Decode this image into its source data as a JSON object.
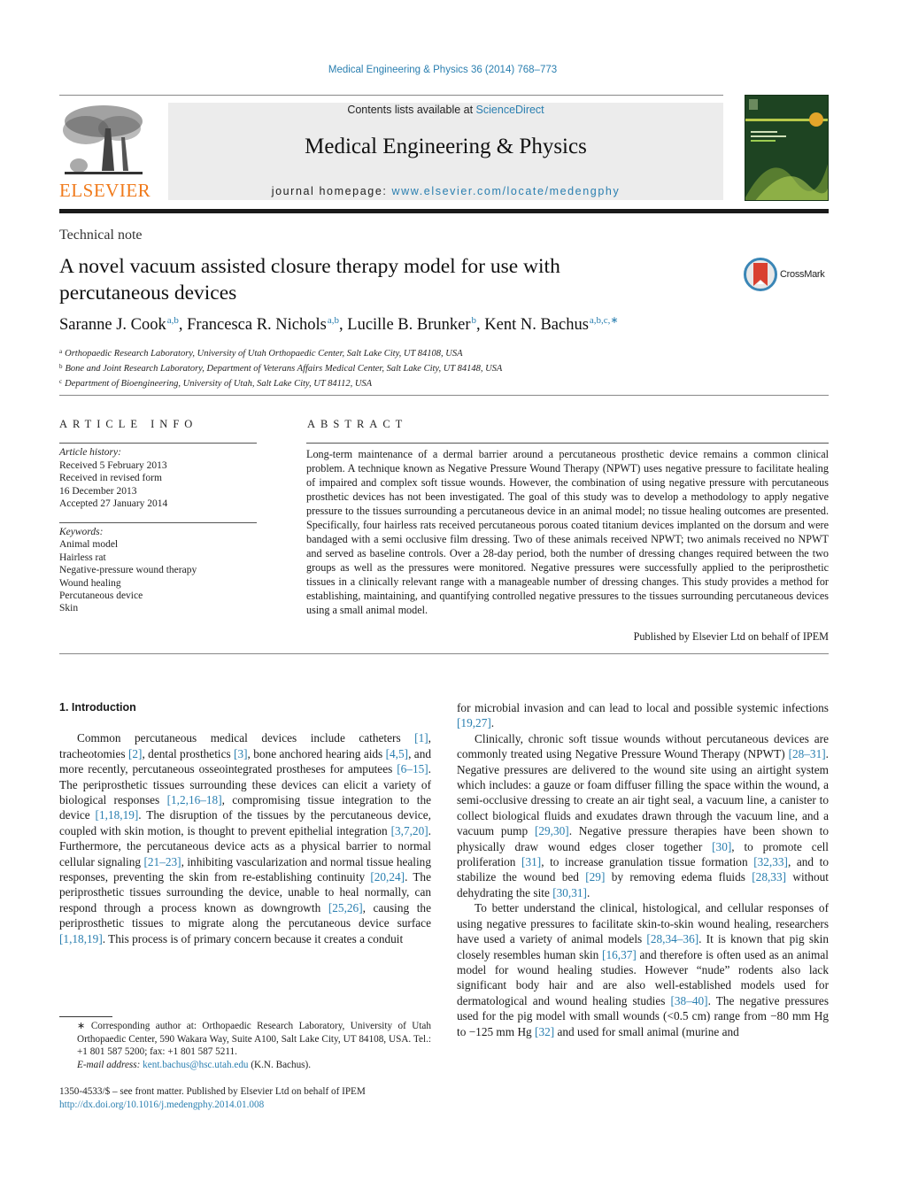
{
  "header": {
    "citation": "Medical Engineering & Physics 36 (2014) 768–773",
    "publisher_logo_text": "ELSEVIER",
    "contents_prefix": "Contents lists available at ",
    "contents_link": "ScienceDirect",
    "journal_title": "Medical Engineering & Physics",
    "homepage_prefix": "journal homepage: ",
    "homepage_link": "www.elsevier.com/locate/medengphy",
    "crossmark_label": "CrossMark"
  },
  "colors": {
    "link": "#2a7fb0",
    "elsevier_orange": "#f07a1b",
    "cover_green": "#1e4422",
    "crossmark_red": "#d9402f"
  },
  "article": {
    "type": "Technical note",
    "title_line1": "A novel vacuum assisted closure therapy model for use with",
    "title_line2": "percutaneous devices",
    "authors": [
      {
        "name": "Saranne J. Cook",
        "sup": "a,b",
        "sep": ", "
      },
      {
        "name": "Francesca R. Nichols",
        "sup": "a,b",
        "sep": ", "
      },
      {
        "name": "Lucille B. Brunker",
        "sup": "b",
        "sep": ", "
      },
      {
        "name": "Kent N. Bachus",
        "sup": "a,b,c,∗",
        "sep": ""
      }
    ],
    "affiliations": [
      {
        "key": "a",
        "text": "Orthopaedic Research Laboratory, University of Utah Orthopaedic Center, Salt Lake City, UT 84108, USA"
      },
      {
        "key": "b",
        "text": "Bone and Joint Research Laboratory, Department of Veterans Affairs Medical Center, Salt Lake City, UT 84148, USA"
      },
      {
        "key": "c",
        "text": "Department of Bioengineering, University of Utah, Salt Lake City, UT 84112, USA"
      }
    ]
  },
  "article_info": {
    "heading": "ARTICLE INFO",
    "history_label": "Article history:",
    "history": [
      "Received 5 February 2013",
      "Received in revised form",
      "16 December 2013",
      "Accepted 27 January 2014"
    ],
    "keywords_label": "Keywords:",
    "keywords": [
      "Animal model",
      "Hairless rat",
      "Negative-pressure wound therapy",
      "Wound healing",
      "Percutaneous device",
      "Skin"
    ]
  },
  "abstract": {
    "heading": "ABSTRACT",
    "text": "Long-term maintenance of a dermal barrier around a percutaneous prosthetic device remains a common clinical problem. A technique known as Negative Pressure Wound Therapy (NPWT) uses negative pressure to facilitate healing of impaired and complex soft tissue wounds. However, the combination of using negative pressure with percutaneous prosthetic devices has not been investigated. The goal of this study was to develop a methodology to apply negative pressure to the tissues surrounding a percutaneous device in an animal model; no tissue healing outcomes are presented. Specifically, four hairless rats received percutaneous porous coated titanium devices implanted on the dorsum and were bandaged with a semi occlusive film dressing. Two of these animals received NPWT; two animals received no NPWT and served as baseline controls. Over a 28-day period, both the number of dressing changes required between the two groups as well as the pressures were monitored. Negative pressures were successfully applied to the periprosthetic tissues in a clinically relevant range with a manageable number of dressing changes. This study provides a method for establishing, maintaining, and quantifying controlled negative pressures to the tissues surrounding percutaneous devices using a small animal model.",
    "publisher_note": "Published by Elsevier Ltd on behalf of IPEM"
  },
  "body": {
    "section_heading": "1.  Introduction",
    "paragraphs": [
      {
        "indent": true,
        "runs": [
          {
            "t": "Common percutaneous medical devices include catheters "
          },
          {
            "t": "[1]",
            "ref": true
          },
          {
            "t": ", tracheotomies "
          },
          {
            "t": "[2]",
            "ref": true
          },
          {
            "t": ", dental prosthetics "
          },
          {
            "t": "[3]",
            "ref": true
          },
          {
            "t": ", bone anchored hearing aids "
          },
          {
            "t": "[4,5]",
            "ref": true
          },
          {
            "t": ", and more recently, percutaneous osseointegrated prostheses for amputees "
          },
          {
            "t": "[6–15]",
            "ref": true
          },
          {
            "t": ". The periprosthetic tissues surrounding these devices can elicit a variety of biological responses "
          },
          {
            "t": "[1,2,16–18]",
            "ref": true
          },
          {
            "t": ", compromising tissue integration to the device "
          },
          {
            "t": "[1,18,19]",
            "ref": true
          },
          {
            "t": ". The disruption of the tissues by the percutaneous device, coupled with skin motion, is thought to prevent epithelial integration "
          },
          {
            "t": "[3,7,20]",
            "ref": true
          },
          {
            "t": ". Furthermore, the percutaneous device acts as a physical barrier to normal cellular signaling "
          },
          {
            "t": "[21–23]",
            "ref": true
          },
          {
            "t": ", inhibiting vascularization and normal tissue healing responses, preventing the skin from re-establishing continuity "
          },
          {
            "t": "[20,24]",
            "ref": true
          },
          {
            "t": ". The periprosthetic tissues surrounding the device, unable to heal normally, can respond through a process known as downgrowth "
          },
          {
            "t": "[25,26]",
            "ref": true
          },
          {
            "t": ", causing the periprosthetic tissues to migrate along the percutaneous device surface "
          },
          {
            "t": "[1,18,19]",
            "ref": true
          },
          {
            "t": ". This process is of primary concern because it creates a conduit"
          }
        ]
      }
    ],
    "right_paragraphs": [
      {
        "indent": false,
        "runs": [
          {
            "t": "for microbial invasion and can lead to local and possible systemic infections "
          },
          {
            "t": "[19,27]",
            "ref": true
          },
          {
            "t": "."
          }
        ]
      },
      {
        "indent": true,
        "runs": [
          {
            "t": "Clinically, chronic soft tissue wounds without percutaneous devices are commonly treated using Negative Pressure Wound Therapy (NPWT) "
          },
          {
            "t": "[28–31]",
            "ref": true
          },
          {
            "t": ". Negative pressures are delivered to the wound site using an airtight system which includes: a gauze or foam diffuser filling the space within the wound, a semi-occlusive dressing to create an air tight seal, a vacuum line, a canister to collect biological fluids and exudates drawn through the vacuum line, and a vacuum pump "
          },
          {
            "t": "[29,30]",
            "ref": true
          },
          {
            "t": ". Negative pressure therapies have been shown to physically draw wound edges closer together "
          },
          {
            "t": "[30]",
            "ref": true
          },
          {
            "t": ", to promote cell proliferation "
          },
          {
            "t": "[31]",
            "ref": true
          },
          {
            "t": ", to increase granulation tissue formation "
          },
          {
            "t": "[32,33]",
            "ref": true
          },
          {
            "t": ", and to stabilize the wound bed "
          },
          {
            "t": "[29]",
            "ref": true
          },
          {
            "t": " by removing edema fluids "
          },
          {
            "t": "[28,33]",
            "ref": true
          },
          {
            "t": " without dehydrating the site "
          },
          {
            "t": "[30,31]",
            "ref": true
          },
          {
            "t": "."
          }
        ]
      },
      {
        "indent": true,
        "runs": [
          {
            "t": "To better understand the clinical, histological, and cellular responses of using negative pressures to facilitate skin-to-skin wound healing, researchers have used a variety of animal models "
          },
          {
            "t": "[28,34–36]",
            "ref": true
          },
          {
            "t": ". It is known that pig skin closely resembles human skin "
          },
          {
            "t": "[16,37]",
            "ref": true
          },
          {
            "t": " and therefore is often used as an animal model for wound healing studies. However “nude” rodents also lack significant body hair and are also well-established models used for dermatological and wound healing studies "
          },
          {
            "t": "[38–40]",
            "ref": true
          },
          {
            "t": ". The negative pressures used for the pig model with small wounds (<0.5 cm) range from −80 mm Hg to −125 mm Hg "
          },
          {
            "t": "[32]",
            "ref": true
          },
          {
            "t": " and used for small animal (murine and"
          }
        ]
      }
    ]
  },
  "footnotes": {
    "corresponding": "∗ Corresponding author at: Orthopaedic Research Laboratory, University of Utah Orthopaedic Center, 590 Wakara Way, Suite A100, Salt Lake City, UT 84108, USA. Tel.: +1 801 587 5200; fax: +1 801 587 5211.",
    "email_label": "E-mail address: ",
    "email": "kent.bachus@hsc.utah.edu",
    "email_suffix": " (K.N. Bachus).",
    "issn_line": "1350-4533/$ – see front matter. Published by Elsevier Ltd on behalf of IPEM",
    "doi": "http://dx.doi.org/10.1016/j.medengphy.2014.01.008"
  }
}
